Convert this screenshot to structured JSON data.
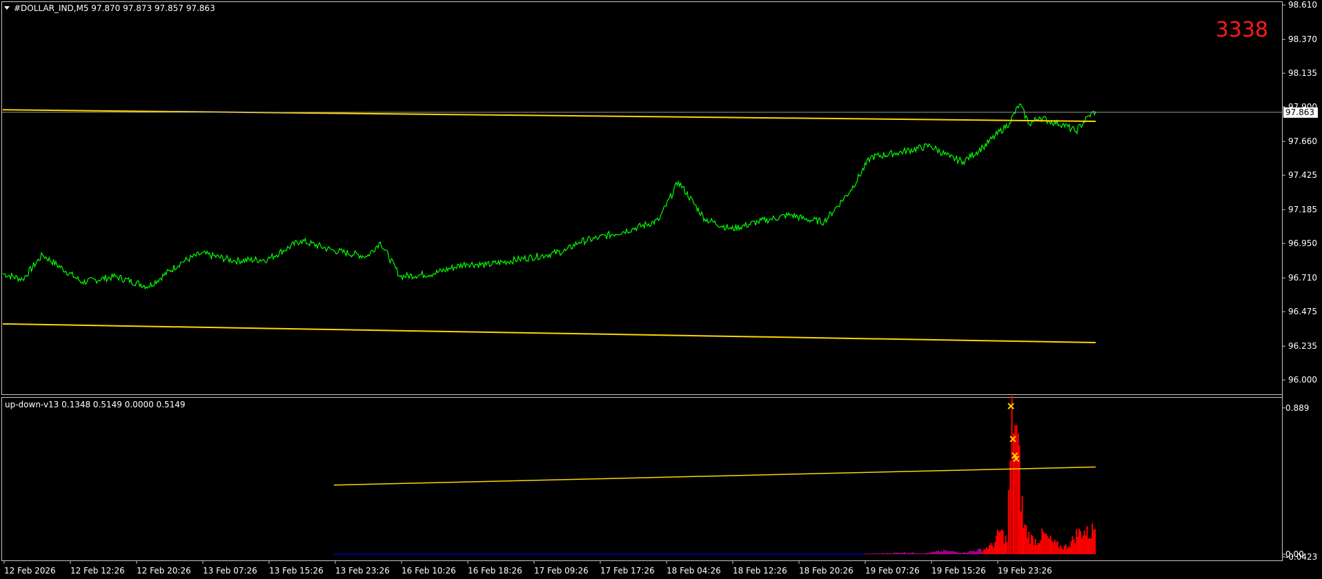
{
  "chart_data": [
    {
      "type": "line",
      "title": "#DOLLAR_IND,M5  97.870 97.873 97.857 97.863",
      "ylim": [
        95.9,
        98.63
      ],
      "y_ticks": [
        "98.610",
        "98.370",
        "98.135",
        "97.900",
        "97.660",
        "97.425",
        "97.185",
        "96.950",
        "96.710",
        "96.475",
        "96.235",
        "96.000"
      ],
      "y_tick_values": [
        98.61,
        98.37,
        98.135,
        97.9,
        97.66,
        97.425,
        97.185,
        96.95,
        96.71,
        96.475,
        96.235,
        96.0
      ],
      "bid": {
        "value": 97.863,
        "label": "97.863"
      },
      "corner_label": "3338",
      "x_ticks": [
        "12 Feb 2026",
        "12 Feb 12:26",
        "12 Feb 20:26",
        "13 Feb 07:26",
        "13 Feb 15:26",
        "13 Feb 23:26",
        "16 Feb 10:26",
        "16 Feb 18:26",
        "17 Feb 09:26",
        "17 Feb 17:26",
        "18 Feb 04:26",
        "18 Feb 12:26",
        "18 Feb 20:26",
        "19 Feb 07:26",
        "19 Feb 15:26",
        "19 Feb 23:26"
      ],
      "series": [
        {
          "color": "#00ff00",
          "x": [
            0,
            0.3,
            0.6,
            1.2,
            1.7,
            2.2,
            2.7,
            3.0,
            3.5,
            4.0,
            4.5,
            5.0,
            5.5,
            5.7,
            6.0,
            6.5,
            7.0,
            7.3,
            7.8,
            8.2,
            8.5,
            8.7,
            9.0,
            9.5,
            9.9,
            10.2,
            10.6,
            11.0,
            11.4,
            11.6,
            11.9,
            12.1,
            12.4,
            12.8,
            13.1,
            13.5,
            14.0,
            14.3,
            14.5,
            14.8,
            15.2
          ],
          "values": [
            96.74,
            96.7,
            96.87,
            96.68,
            96.72,
            96.65,
            96.82,
            96.88,
            96.83,
            96.84,
            96.97,
            96.9,
            96.86,
            96.96,
            96.72,
            96.74,
            96.81,
            96.8,
            96.84,
            96.87,
            96.9,
            96.96,
            96.99,
            97.05,
            97.11,
            97.38,
            97.12,
            97.05,
            97.1,
            97.12,
            97.15,
            97.12,
            97.1,
            97.32,
            97.55,
            97.58,
            97.63,
            97.55,
            97.52,
            97.62,
            97.79
          ]
        },
        {
          "color": "#00ff00",
          "x": [
            15.2,
            15.35,
            15.5,
            15.65,
            15.8,
            16.0,
            16.2,
            16.4,
            16.5
          ],
          "values": [
            97.79,
            97.92,
            97.78,
            97.83,
            97.8,
            97.78,
            97.73,
            97.84,
            97.87
          ]
        },
        {
          "color": "#ffd700",
          "x": [
            0,
            16.5
          ],
          "values": [
            97.88,
            97.8
          ]
        },
        {
          "color": "#ffd700",
          "x": [
            0,
            16.5
          ],
          "values": [
            96.39,
            96.26
          ]
        }
      ]
    },
    {
      "type": "bar",
      "title": "up-down-v13 0.1348 0.5149 0.0000 0.5149",
      "ylim": [
        0.0,
        0.93
      ],
      "y_ticks": [
        "0.889",
        "0.00",
        "-0.0423"
      ],
      "y_tick_values": [
        0.889,
        0.0,
        -0.0423
      ],
      "x": [
        13.0,
        13.3,
        13.6,
        13.9,
        14.2,
        14.5,
        14.8,
        14.95,
        15.05,
        15.15,
        15.2,
        15.25,
        15.32,
        15.4,
        15.5,
        15.6,
        15.7,
        15.85,
        16.0,
        16.1,
        16.2,
        16.3,
        16.4,
        16.5
      ],
      "values": [
        0.003,
        0.005,
        0.01,
        0.005,
        0.02,
        0.01,
        0.03,
        0.06,
        0.14,
        0.08,
        0.55,
        0.92,
        0.6,
        0.18,
        0.1,
        0.08,
        0.12,
        0.07,
        0.04,
        0.06,
        0.12,
        0.14,
        0.12,
        0.18
      ],
      "markers": [
        [
          15.22,
          0.9
        ],
        [
          15.25,
          0.7
        ],
        [
          15.28,
          0.6
        ],
        [
          15.3,
          0.58
        ]
      ],
      "series": [
        {
          "color": "#ffd700",
          "x": [
            5.0,
            16.5
          ],
          "values": [
            0.42,
            0.53
          ]
        },
        {
          "color": "#0000cc",
          "x": [
            5.0,
            13.0
          ],
          "values": [
            0.0,
            0.0
          ]
        }
      ]
    }
  ]
}
